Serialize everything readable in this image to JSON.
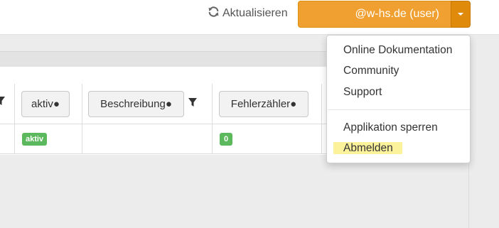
{
  "topbar": {
    "refresh_icon": "refresh-icon",
    "refresh_label": "Aktualisieren",
    "user_label": "@w-hs.de (user)",
    "caret_icon": "caret-down-icon",
    "accent_color": "#f0a030"
  },
  "table": {
    "columns": [
      {
        "label": "aktiv●"
      },
      {
        "label": "Beschreibung●"
      },
      {
        "label": "Fehlerzähler●"
      }
    ],
    "filter_icon": "filter-icon",
    "row": {
      "status_badge": "aktiv",
      "error_count": "0"
    },
    "badge_color": "#5cb85c"
  },
  "dropdown": {
    "items": [
      {
        "label": "Online Dokumentation"
      },
      {
        "label": "Community"
      },
      {
        "label": "Support"
      }
    ],
    "items2": [
      {
        "label": "Applikation sperren"
      },
      {
        "label": "Abmelden"
      }
    ],
    "highlight_color": "#fbf29b"
  }
}
